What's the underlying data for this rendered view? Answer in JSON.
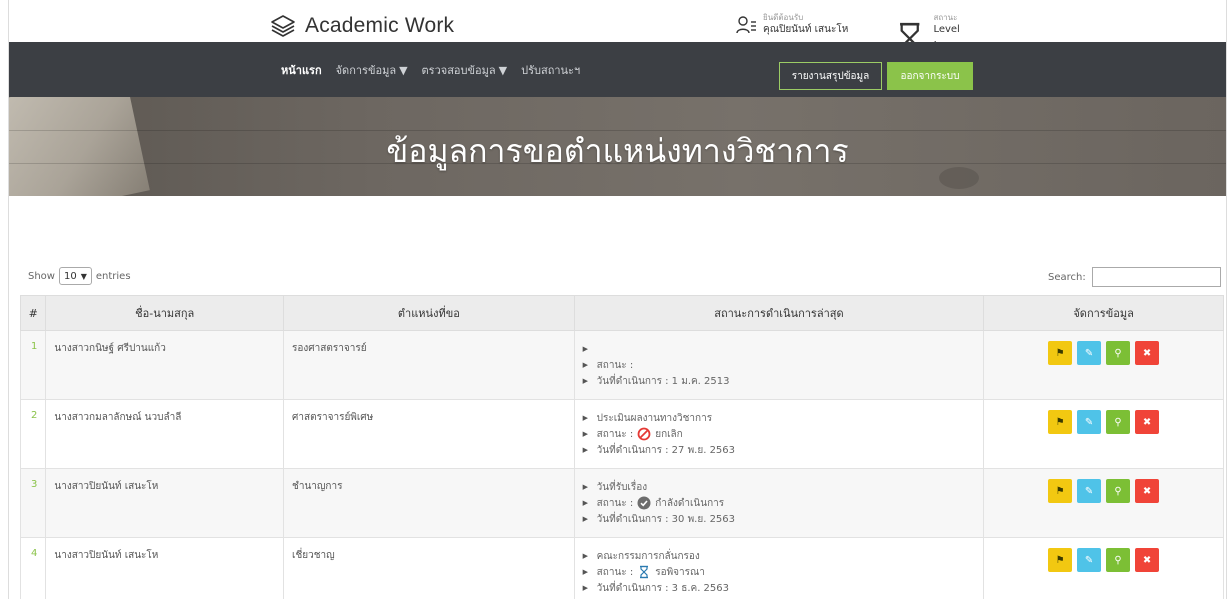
{
  "header": {
    "brand": "Academic Work",
    "welcome_label": "ยินดีต้อนรับ",
    "user_name": "คุณปิยนันท์ เสนะโห",
    "status_label": "สถานะ",
    "level": "Level : Admin"
  },
  "nav": {
    "items": [
      {
        "label": "หน้าแรก",
        "active": true
      },
      {
        "label": "จัดการข้อมูล",
        "dropdown": true
      },
      {
        "label": "ตรวจสอบข้อมูล",
        "dropdown": true
      },
      {
        "label": "ปรับสถานะฯ"
      }
    ],
    "report_button": "รายงานสรุปข้อมูล",
    "logout_button": "ออกจากระบบ"
  },
  "hero": {
    "title": "ข้อมูลการขอตำแหน่งทางวิชาการ"
  },
  "table_controls": {
    "show": "Show",
    "entries_value": "10",
    "entries": "entries",
    "search_label": "Search:"
  },
  "table": {
    "columns": [
      "#",
      "ชื่อ-นามสกุล",
      "ตำแหน่งที่ขอ",
      "สถานะการดำเนินการล่าสุด",
      "จัดการข้อมูล"
    ],
    "rows": [
      {
        "num": "1",
        "name": "นางสาวกนิษฐ์ ศรีปานแก้ว",
        "position": "รองศาสตราจารย์",
        "step": "",
        "status_prefix": "สถานะ :",
        "status_text": "",
        "status_icon": "",
        "date": "วันที่ดำเนินการ : 1 ม.ค. 2513"
      },
      {
        "num": "2",
        "name": "นางสาวกมลาลักษณ์ นวบลำลี",
        "position": "ศาสตราจารย์พิเศษ",
        "step": "ประเมินผลงานทางวิชาการ",
        "status_prefix": "สถานะ :",
        "status_text": "ยกเลิก",
        "status_icon": "cancel-icon",
        "date": "วันที่ดำเนินการ : 27 พ.ย. 2563"
      },
      {
        "num": "3",
        "name": "นางสาวปิยนันท์ เสนะโห",
        "position": "ชำนาญการ",
        "step": "วันที่รับเรื่อง",
        "status_prefix": "สถานะ :",
        "status_text": "กำลังดำเนินการ",
        "status_icon": "check-circle-icon",
        "date": "วันที่ดำเนินการ : 30 พ.ย. 2563"
      },
      {
        "num": "4",
        "name": "นางสาวปิยนันท์ เสนะโห",
        "position": "เชี่ยวชาญ",
        "step": "คณะกรรมการกลั่นกรอง",
        "status_prefix": "สถานะ :",
        "status_text": "รอพิจารณา",
        "status_icon": "hourglass-icon",
        "date": "วันที่ดำเนินการ : 3 ธ.ค. 2563"
      }
    ]
  },
  "colors": {
    "nav_bg": "#3c3f44",
    "accent_green": "#8bc34a",
    "btn_yellow": "#f2c811",
    "btn_blue": "#4fc3e8",
    "btn_green": "#7cbf35",
    "btn_red": "#f04438"
  }
}
